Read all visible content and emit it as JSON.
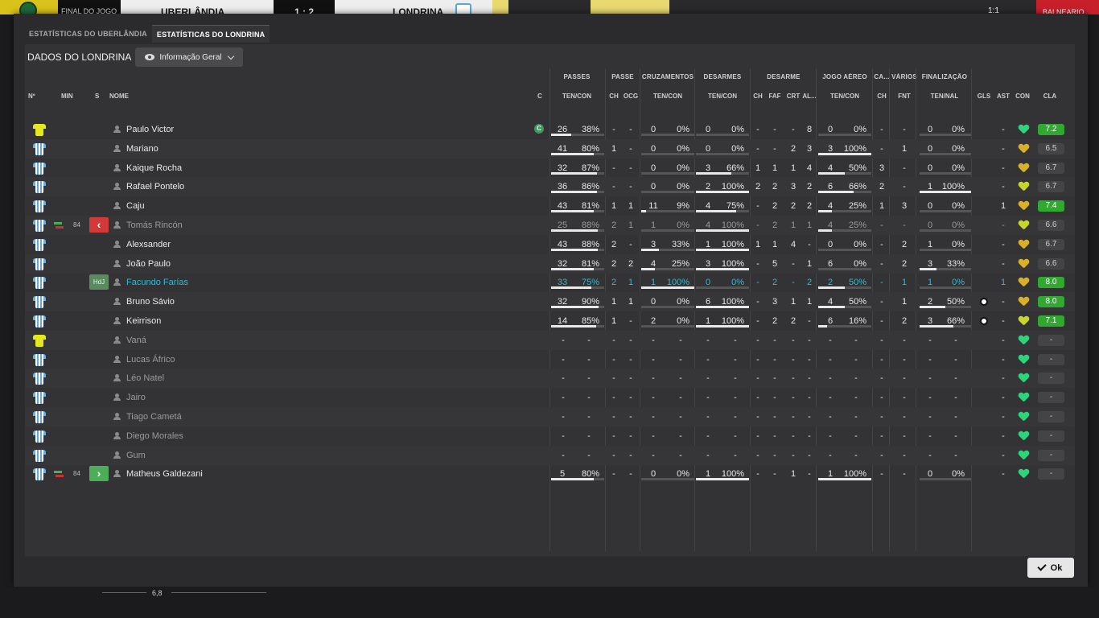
{
  "topbar": {
    "match_state": "FINAL DO JOGO",
    "home_team": "UBERLÂNDIA",
    "score": "1 : 2",
    "away_team": "LONDRINA",
    "right_label": "1:1",
    "red_label": "BALNEARIO"
  },
  "tabs": [
    {
      "label": "ESTATÍSTICAS DO UBERLÂNDIA",
      "active": false
    },
    {
      "label": "ESTATÍSTICAS DO LONDRINA",
      "active": true
    }
  ],
  "section": {
    "title": "DADOS DO LONDRINA",
    "view": "Informação Geral"
  },
  "groups": [
    "PASSES",
    "PASSE",
    "CRUZAMENTOS",
    "DESARMES",
    "DESARME",
    "JOGO AÉREO",
    "CA...",
    "VÁRIOS",
    "FINALIZAÇÃO"
  ],
  "headers": [
    "Nº",
    "MIN",
    "S",
    "NOME",
    "C",
    "TEN/CON",
    "CH",
    "OCG",
    "TEN/CON",
    "TEN/CON",
    "CH",
    "FAF",
    "CRT",
    "AL...",
    "TEN/CON",
    "CH",
    "FNT",
    "TEN/NAL",
    "GLS",
    "AST",
    "CON",
    "CLA"
  ],
  "players": [
    {
      "name": "Paulo Victor",
      "gk": true,
      "captain": "C",
      "passes": [
        "26",
        "38%"
      ],
      "pf": 38,
      "ch": "-",
      "ocg": "-",
      "cruz": [
        "0",
        "0%"
      ],
      "cf": 0,
      "des": [
        "0",
        "0%"
      ],
      "df": 0,
      "d_ch": "-",
      "faf": "-",
      "crt": "-",
      "al": "8",
      "aer": [
        "0",
        "0%"
      ],
      "af": 0,
      "ca": "-",
      "fnt": "-",
      "fin": [
        "0",
        "0%"
      ],
      "ff": 0,
      "gls": "",
      "ast": "-",
      "con": "green",
      "cla": "7.2",
      "cla_hi": true
    },
    {
      "name": "Mariano",
      "passes": [
        "41",
        "80%"
      ],
      "pf": 80,
      "ch": "1",
      "ocg": "-",
      "cruz": [
        "0",
        "0%"
      ],
      "cf": 0,
      "des": [
        "0",
        "0%"
      ],
      "df": 0,
      "d_ch": "-",
      "faf": "-",
      "crt": "2",
      "al": "3",
      "aer": [
        "3",
        "100%"
      ],
      "af": 100,
      "ca": "-",
      "fnt": "1",
      "fin": [
        "0",
        "0%"
      ],
      "ff": 0,
      "gls": "",
      "ast": "-",
      "con": "gold",
      "cla": "6.5"
    },
    {
      "name": "Kaique Rocha",
      "passes": [
        "32",
        "87%"
      ],
      "pf": 87,
      "ch": "-",
      "ocg": "-",
      "cruz": [
        "0",
        "0%"
      ],
      "cf": 0,
      "des": [
        "3",
        "66%"
      ],
      "df": 66,
      "d_ch": "1",
      "faf": "1",
      "crt": "1",
      "al": "4",
      "aer": [
        "4",
        "50%"
      ],
      "af": 50,
      "ca": "3",
      "fnt": "-",
      "fin": [
        "0",
        "0%"
      ],
      "ff": 0,
      "gls": "",
      "ast": "-",
      "con": "gold",
      "cla": "6.7"
    },
    {
      "name": "Rafael Pontelo",
      "passes": [
        "36",
        "86%"
      ],
      "pf": 86,
      "ch": "-",
      "ocg": "-",
      "cruz": [
        "0",
        "0%"
      ],
      "cf": 0,
      "des": [
        "2",
        "100%"
      ],
      "df": 100,
      "d_ch": "2",
      "faf": "2",
      "crt": "3",
      "al": "2",
      "aer": [
        "6",
        "66%"
      ],
      "af": 66,
      "ca": "2",
      "fnt": "-",
      "fin": [
        "1",
        "100%"
      ],
      "ff": 100,
      "gls": "",
      "ast": "-",
      "con": "lime",
      "cla": "6.7"
    },
    {
      "name": "Caju",
      "passes": [
        "43",
        "81%"
      ],
      "pf": 81,
      "ch": "1",
      "ocg": "1",
      "cruz": [
        "11",
        "9%"
      ],
      "cf": 9,
      "des": [
        "4",
        "75%"
      ],
      "df": 75,
      "d_ch": "-",
      "faf": "2",
      "crt": "2",
      "al": "2",
      "aer": [
        "4",
        "25%"
      ],
      "af": 25,
      "ca": "1",
      "fnt": "3",
      "fin": [
        "0",
        "0%"
      ],
      "ff": 0,
      "gls": "",
      "ast": "1",
      "con": "gold",
      "cla": "7.4",
      "cla_hi": true
    },
    {
      "name": "Tomás Rincón",
      "sub": "out",
      "min": "84",
      "passes": [
        "25",
        "88%"
      ],
      "pf": 88,
      "ch": "2",
      "ocg": "1",
      "cruz": [
        "1",
        "0%"
      ],
      "cf": 0,
      "des": [
        "4",
        "100%"
      ],
      "df": 100,
      "d_ch": "-",
      "faf": "2",
      "crt": "1",
      "al": "1",
      "aer": [
        "4",
        "25%"
      ],
      "af": 25,
      "ca": "-",
      "fnt": "-",
      "fin": [
        "0",
        "0%"
      ],
      "ff": 0,
      "gls": "",
      "ast": "-",
      "con": "lime",
      "cla": "6.6",
      "dim": true
    },
    {
      "name": "Alexsander",
      "passes": [
        "43",
        "88%"
      ],
      "pf": 88,
      "ch": "2",
      "ocg": "-",
      "cruz": [
        "3",
        "33%"
      ],
      "cf": 33,
      "des": [
        "1",
        "100%"
      ],
      "df": 100,
      "d_ch": "1",
      "faf": "1",
      "crt": "4",
      "al": "-",
      "aer": [
        "0",
        "0%"
      ],
      "af": 0,
      "ca": "-",
      "fnt": "2",
      "fin": [
        "1",
        "0%"
      ],
      "ff": 0,
      "gls": "",
      "ast": "-",
      "con": "gold",
      "cla": "6.7"
    },
    {
      "name": "João Paulo",
      "passes": [
        "32",
        "81%"
      ],
      "pf": 81,
      "ch": "2",
      "ocg": "2",
      "cruz": [
        "4",
        "25%"
      ],
      "cf": 25,
      "des": [
        "3",
        "100%"
      ],
      "df": 100,
      "d_ch": "-",
      "faf": "5",
      "crt": "-",
      "al": "1",
      "aer": [
        "6",
        "0%"
      ],
      "af": 0,
      "ca": "-",
      "fnt": "2",
      "fin": [
        "3",
        "33%"
      ],
      "ff": 33,
      "gls": "",
      "ast": "-",
      "con": "gold",
      "cla": "6.6"
    },
    {
      "name": "Facundo Farías",
      "badge": "HdJ",
      "passes": [
        "33",
        "75%"
      ],
      "pf": 75,
      "ch": "2",
      "ocg": "1",
      "cruz": [
        "1",
        "100%"
      ],
      "cf": 100,
      "des": [
        "0",
        "0%"
      ],
      "df": 0,
      "d_ch": "-",
      "faf": "2",
      "crt": "-",
      "al": "2",
      "aer": [
        "2",
        "50%"
      ],
      "af": 50,
      "ca": "-",
      "fnt": "1",
      "fin": [
        "1",
        "0%"
      ],
      "ff": 0,
      "gls": "",
      "ast": "1",
      "con": "gold",
      "cla": "8.0",
      "cla_hi": true,
      "cyan": true
    },
    {
      "name": "Bruno Sávio",
      "passes": [
        "32",
        "90%"
      ],
      "pf": 90,
      "ch": "1",
      "ocg": "1",
      "cruz": [
        "0",
        "0%"
      ],
      "cf": 0,
      "des": [
        "6",
        "100%"
      ],
      "df": 100,
      "d_ch": "-",
      "faf": "3",
      "crt": "1",
      "al": "1",
      "aer": [
        "4",
        "50%"
      ],
      "af": 50,
      "ca": "-",
      "fnt": "1",
      "fin": [
        "2",
        "50%"
      ],
      "ff": 50,
      "gls": "ball",
      "ast": "-",
      "con": "gold",
      "cla": "8.0",
      "cla_hi": true
    },
    {
      "name": "Keirrison",
      "passes": [
        "14",
        "85%"
      ],
      "pf": 85,
      "ch": "1",
      "ocg": "-",
      "cruz": [
        "2",
        "0%"
      ],
      "cf": 0,
      "des": [
        "1",
        "100%"
      ],
      "df": 100,
      "d_ch": "-",
      "faf": "2",
      "crt": "2",
      "al": "-",
      "aer": [
        "6",
        "16%"
      ],
      "af": 16,
      "ca": "-",
      "fnt": "2",
      "fin": [
        "3",
        "66%"
      ],
      "ff": 66,
      "gls": "ball",
      "ast": "-",
      "con": "lime",
      "cla": "7.1",
      "cla_hi": true
    },
    {
      "name": "Vaná",
      "gk": true,
      "empty": true,
      "con": "green",
      "cla": "-"
    },
    {
      "name": "Lucas Áfrico",
      "empty": true,
      "con": "green",
      "cla": "-"
    },
    {
      "name": "Léo Natel",
      "empty": true,
      "con": "green",
      "cla": "-"
    },
    {
      "name": "Jairo",
      "empty": true,
      "con": "green",
      "cla": "-"
    },
    {
      "name": "Tiago Cametá",
      "empty": true,
      "con": "green",
      "cla": "-"
    },
    {
      "name": "Diego Morales",
      "empty": true,
      "con": "green",
      "cla": "-"
    },
    {
      "name": "Gum",
      "empty": true,
      "con": "green",
      "cla": "-"
    },
    {
      "name": "Matheus Galdezani",
      "sub": "in",
      "min": "84",
      "passes": [
        "5",
        "80%"
      ],
      "pf": 80,
      "ch": "-",
      "ocg": "-",
      "cruz": [
        "0",
        "0%"
      ],
      "cf": 0,
      "des": [
        "1",
        "100%"
      ],
      "df": 100,
      "d_ch": "-",
      "faf": "-",
      "crt": "1",
      "al": "-",
      "aer": [
        "1",
        "100%"
      ],
      "af": 100,
      "ca": "-",
      "fnt": "-",
      "fin": [
        "0",
        "0%"
      ],
      "ff": 0,
      "gls": "",
      "ast": "-",
      "con": "green",
      "cla": "-"
    }
  ],
  "footer": {
    "ok_label": "Ok",
    "bottom_value": "6,8"
  },
  "colors": {
    "accent_green": "#31a830",
    "captain": "#3a9a60",
    "cyan_name": "#39b6cf",
    "out_badge": "#d23a3a",
    "in_badge": "#4cae5a"
  }
}
